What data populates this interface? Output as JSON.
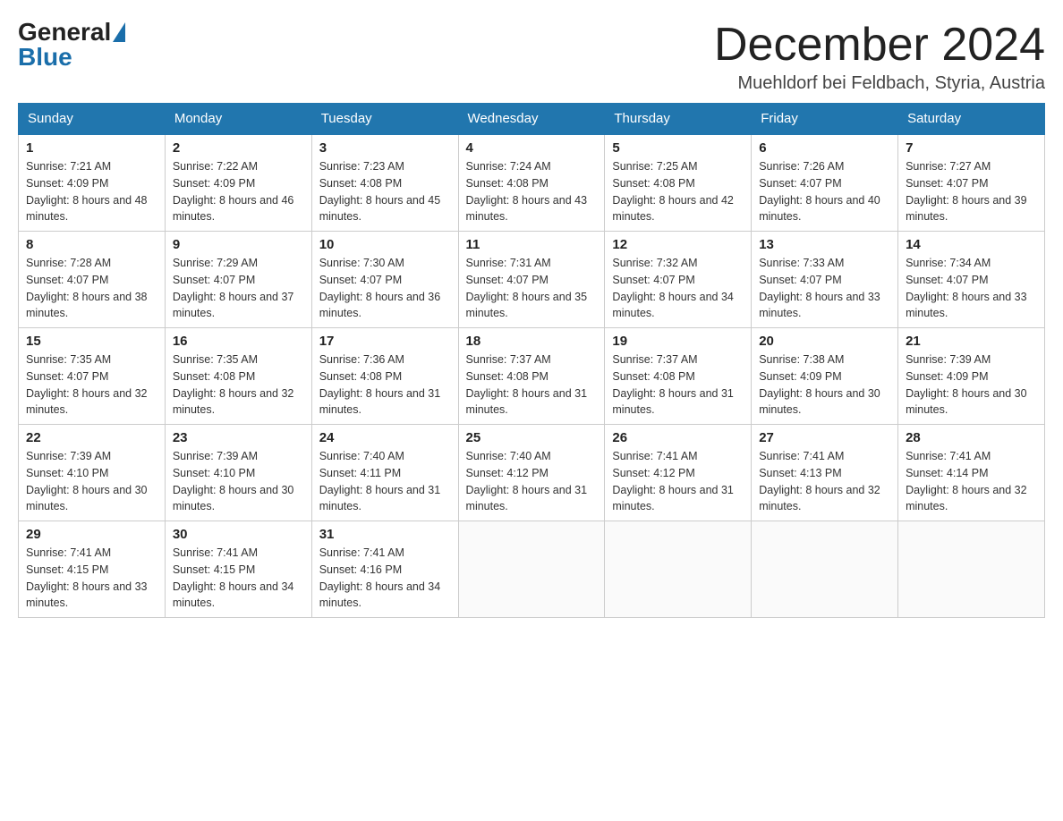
{
  "header": {
    "logo_general": "General",
    "logo_blue": "Blue",
    "month_title": "December 2024",
    "subtitle": "Muehldorf bei Feldbach, Styria, Austria"
  },
  "weekdays": [
    "Sunday",
    "Monday",
    "Tuesday",
    "Wednesday",
    "Thursday",
    "Friday",
    "Saturday"
  ],
  "weeks": [
    [
      {
        "day": "1",
        "sunrise": "7:21 AM",
        "sunset": "4:09 PM",
        "daylight": "8 hours and 48 minutes."
      },
      {
        "day": "2",
        "sunrise": "7:22 AM",
        "sunset": "4:09 PM",
        "daylight": "8 hours and 46 minutes."
      },
      {
        "day": "3",
        "sunrise": "7:23 AM",
        "sunset": "4:08 PM",
        "daylight": "8 hours and 45 minutes."
      },
      {
        "day": "4",
        "sunrise": "7:24 AM",
        "sunset": "4:08 PM",
        "daylight": "8 hours and 43 minutes."
      },
      {
        "day": "5",
        "sunrise": "7:25 AM",
        "sunset": "4:08 PM",
        "daylight": "8 hours and 42 minutes."
      },
      {
        "day": "6",
        "sunrise": "7:26 AM",
        "sunset": "4:07 PM",
        "daylight": "8 hours and 40 minutes."
      },
      {
        "day": "7",
        "sunrise": "7:27 AM",
        "sunset": "4:07 PM",
        "daylight": "8 hours and 39 minutes."
      }
    ],
    [
      {
        "day": "8",
        "sunrise": "7:28 AM",
        "sunset": "4:07 PM",
        "daylight": "8 hours and 38 minutes."
      },
      {
        "day": "9",
        "sunrise": "7:29 AM",
        "sunset": "4:07 PM",
        "daylight": "8 hours and 37 minutes."
      },
      {
        "day": "10",
        "sunrise": "7:30 AM",
        "sunset": "4:07 PM",
        "daylight": "8 hours and 36 minutes."
      },
      {
        "day": "11",
        "sunrise": "7:31 AM",
        "sunset": "4:07 PM",
        "daylight": "8 hours and 35 minutes."
      },
      {
        "day": "12",
        "sunrise": "7:32 AM",
        "sunset": "4:07 PM",
        "daylight": "8 hours and 34 minutes."
      },
      {
        "day": "13",
        "sunrise": "7:33 AM",
        "sunset": "4:07 PM",
        "daylight": "8 hours and 33 minutes."
      },
      {
        "day": "14",
        "sunrise": "7:34 AM",
        "sunset": "4:07 PM",
        "daylight": "8 hours and 33 minutes."
      }
    ],
    [
      {
        "day": "15",
        "sunrise": "7:35 AM",
        "sunset": "4:07 PM",
        "daylight": "8 hours and 32 minutes."
      },
      {
        "day": "16",
        "sunrise": "7:35 AM",
        "sunset": "4:08 PM",
        "daylight": "8 hours and 32 minutes."
      },
      {
        "day": "17",
        "sunrise": "7:36 AM",
        "sunset": "4:08 PM",
        "daylight": "8 hours and 31 minutes."
      },
      {
        "day": "18",
        "sunrise": "7:37 AM",
        "sunset": "4:08 PM",
        "daylight": "8 hours and 31 minutes."
      },
      {
        "day": "19",
        "sunrise": "7:37 AM",
        "sunset": "4:08 PM",
        "daylight": "8 hours and 31 minutes."
      },
      {
        "day": "20",
        "sunrise": "7:38 AM",
        "sunset": "4:09 PM",
        "daylight": "8 hours and 30 minutes."
      },
      {
        "day": "21",
        "sunrise": "7:39 AM",
        "sunset": "4:09 PM",
        "daylight": "8 hours and 30 minutes."
      }
    ],
    [
      {
        "day": "22",
        "sunrise": "7:39 AM",
        "sunset": "4:10 PM",
        "daylight": "8 hours and 30 minutes."
      },
      {
        "day": "23",
        "sunrise": "7:39 AM",
        "sunset": "4:10 PM",
        "daylight": "8 hours and 30 minutes."
      },
      {
        "day": "24",
        "sunrise": "7:40 AM",
        "sunset": "4:11 PM",
        "daylight": "8 hours and 31 minutes."
      },
      {
        "day": "25",
        "sunrise": "7:40 AM",
        "sunset": "4:12 PM",
        "daylight": "8 hours and 31 minutes."
      },
      {
        "day": "26",
        "sunrise": "7:41 AM",
        "sunset": "4:12 PM",
        "daylight": "8 hours and 31 minutes."
      },
      {
        "day": "27",
        "sunrise": "7:41 AM",
        "sunset": "4:13 PM",
        "daylight": "8 hours and 32 minutes."
      },
      {
        "day": "28",
        "sunrise": "7:41 AM",
        "sunset": "4:14 PM",
        "daylight": "8 hours and 32 minutes."
      }
    ],
    [
      {
        "day": "29",
        "sunrise": "7:41 AM",
        "sunset": "4:15 PM",
        "daylight": "8 hours and 33 minutes."
      },
      {
        "day": "30",
        "sunrise": "7:41 AM",
        "sunset": "4:15 PM",
        "daylight": "8 hours and 34 minutes."
      },
      {
        "day": "31",
        "sunrise": "7:41 AM",
        "sunset": "4:16 PM",
        "daylight": "8 hours and 34 minutes."
      },
      null,
      null,
      null,
      null
    ]
  ]
}
